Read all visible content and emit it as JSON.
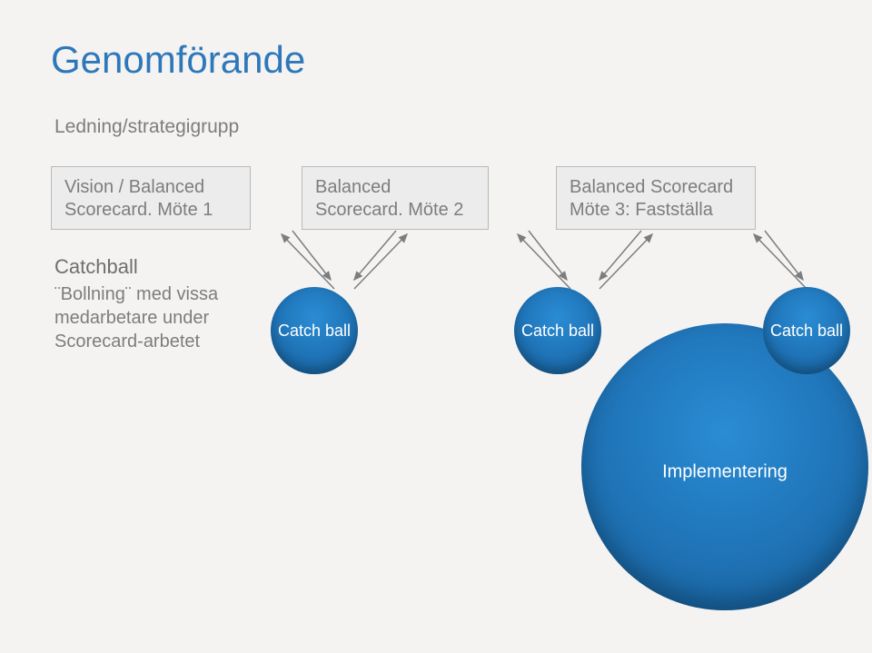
{
  "title": "Genomförande",
  "subtitle": "Ledning/strategigrupp",
  "boxes": {
    "b1": "Vision / Balanced Scorecard. Möte 1",
    "b2": "Balanced Scorecard. Möte 2",
    "b3": "Balanced Scorecard Möte 3: Fastställa"
  },
  "catchball": {
    "heading": "Catchball",
    "body": "¨Bollning¨ med vissa medarbetare under Scorecard-arbetet"
  },
  "circles": {
    "small": "Catch ball",
    "big": "Implementering"
  }
}
